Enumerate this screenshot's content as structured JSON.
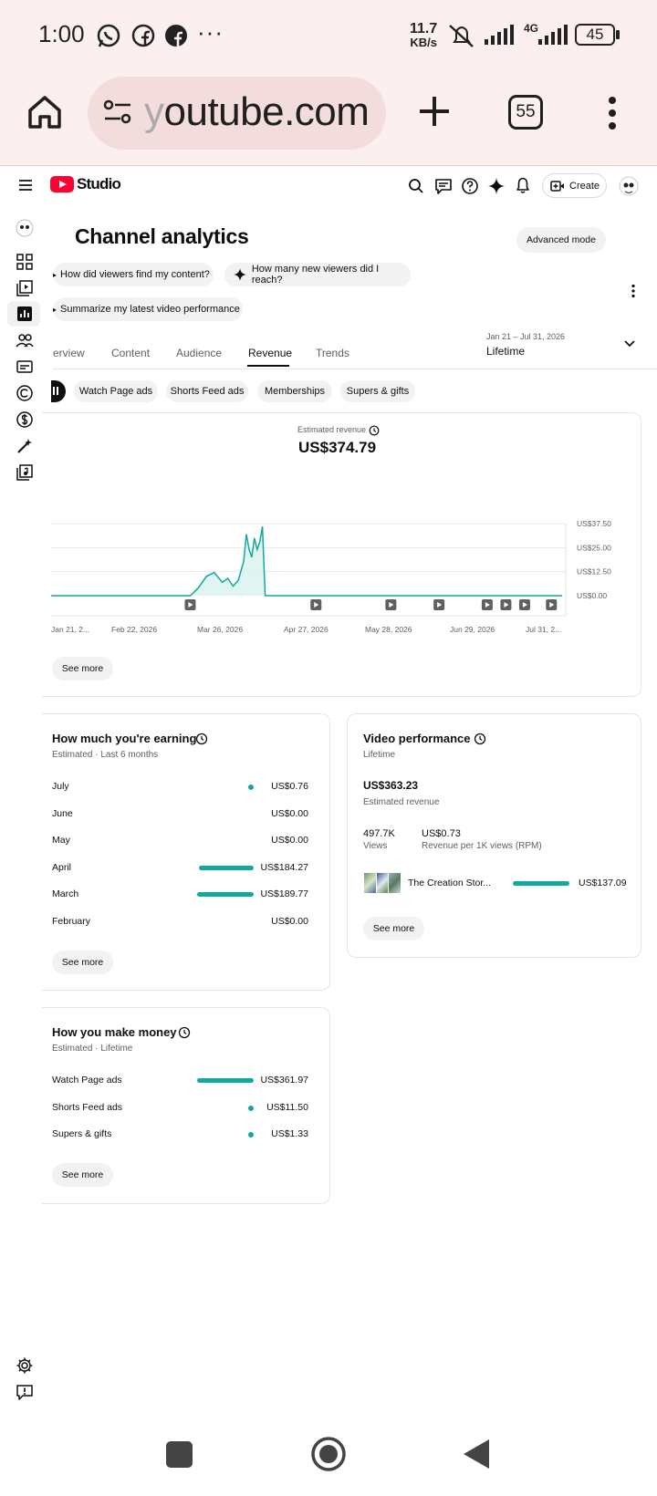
{
  "status": {
    "time": "1:00",
    "network_speed": "11.7",
    "network_unit": "KB/s",
    "network_type": "4G",
    "battery": "45",
    "icons": [
      "whatsapp-icon",
      "facebook-outline-icon",
      "facebook-icon",
      "more-dots-icon",
      "mute-icon",
      "signal-icon",
      "signal-icon",
      "battery-icon"
    ]
  },
  "browser": {
    "url_prefix": "y",
    "url_rest": "outube.com",
    "tab_count": "55"
  },
  "studio": {
    "logo_text": "Studio",
    "create_label": "Create",
    "page_title": "Channel analytics",
    "advanced_mode": "Advanced mode",
    "questions": [
      "How did viewers find my content?",
      "How many new viewers did I reach?",
      "Summarize my latest video performance"
    ],
    "tabs": [
      "erview",
      "Content",
      "Audience",
      "Revenue",
      "Trends"
    ],
    "active_tab": "Revenue",
    "date_range": "Jan 21 – Jul 31, 2026",
    "date_period": "Lifetime",
    "filters": [
      "Watch Page ads",
      "Shorts Feed ads",
      "Memberships",
      "Supers & gifts"
    ]
  },
  "colors": {
    "accent": "#12a89d",
    "youtube_red": "#ff0033",
    "chart_fill": "#d8f1ef"
  },
  "revenue_chart": {
    "label": "Estimated revenue",
    "total": "US$374.79",
    "see_more": "See more"
  },
  "chart_data": {
    "type": "area",
    "title": "Estimated revenue",
    "x_tick_labels": [
      "Jan 21, 2...",
      "Feb 22, 2026",
      "Mar 26, 2026",
      "Apr 27, 2026",
      "May 28, 2026",
      "Jun 29, 2026",
      "Jul 31, 2..."
    ],
    "y_tick_labels": [
      "US$37.50",
      "US$25.00",
      "US$12.50",
      "US$0.00"
    ],
    "ylim": [
      0,
      37.5
    ],
    "grid": true,
    "series": [
      {
        "values": [
          [
            "2026-01-21",
            0
          ],
          [
            "2026-02-22",
            0
          ],
          [
            "2026-03-14",
            0
          ],
          [
            "2026-03-17",
            4
          ],
          [
            "2026-03-20",
            10
          ],
          [
            "2026-03-23",
            12
          ],
          [
            "2026-03-26",
            7
          ],
          [
            "2026-03-28",
            9
          ],
          [
            "2026-03-30",
            5
          ],
          [
            "2026-04-01",
            8
          ],
          [
            "2026-04-03",
            18
          ],
          [
            "2026-04-04",
            32
          ],
          [
            "2026-04-05",
            24
          ],
          [
            "2026-04-06",
            20
          ],
          [
            "2026-04-07",
            30
          ],
          [
            "2026-04-08",
            24
          ],
          [
            "2026-04-09",
            28
          ],
          [
            "2026-04-10",
            36
          ],
          [
            "2026-04-11",
            0
          ],
          [
            "2026-07-31",
            0
          ]
        ]
      }
    ],
    "video_markers": [
      "2026-03-14",
      "2026-04-30",
      "2026-05-28",
      "2026-06-15",
      "2026-07-03",
      "2026-07-10",
      "2026-07-17",
      "2026-07-27"
    ]
  },
  "earning": {
    "title": "How much you're earning",
    "subtitle": "Estimated · Last 6 months",
    "rows": [
      {
        "label": "July",
        "value": "US$0.76",
        "share": 0.004
      },
      {
        "label": "June",
        "value": "US$0.00",
        "share": 0
      },
      {
        "label": "May",
        "value": "US$0.00",
        "share": 0
      },
      {
        "label": "April",
        "value": "US$184.27",
        "share": 0.971
      },
      {
        "label": "March",
        "value": "US$189.77",
        "share": 1.0
      },
      {
        "label": "February",
        "value": "US$0.00",
        "share": 0
      }
    ],
    "see_more": "See more"
  },
  "video_performance": {
    "title": "Video performance",
    "subtitle": "Lifetime",
    "revenue": "US$363.23",
    "revenue_label": "Estimated revenue",
    "views": "497.7K",
    "views_label": "Views",
    "rpm": "US$0.73",
    "rpm_label": "Revenue per 1K views (RPM)",
    "top_video_title": "The Creation Stor...",
    "top_video_value": "US$137.09",
    "top_video_share": 1.0,
    "see_more": "See more"
  },
  "make_money": {
    "title": "How you make money",
    "subtitle": "Estimated · Lifetime",
    "rows": [
      {
        "label": "Watch Page ads",
        "value": "US$361.97",
        "share": 1.0
      },
      {
        "label": "Shorts Feed ads",
        "value": "US$11.50",
        "share": 0.032
      },
      {
        "label": "Supers & gifts",
        "value": "US$1.33",
        "share": 0.004
      }
    ],
    "see_more": "See more"
  }
}
